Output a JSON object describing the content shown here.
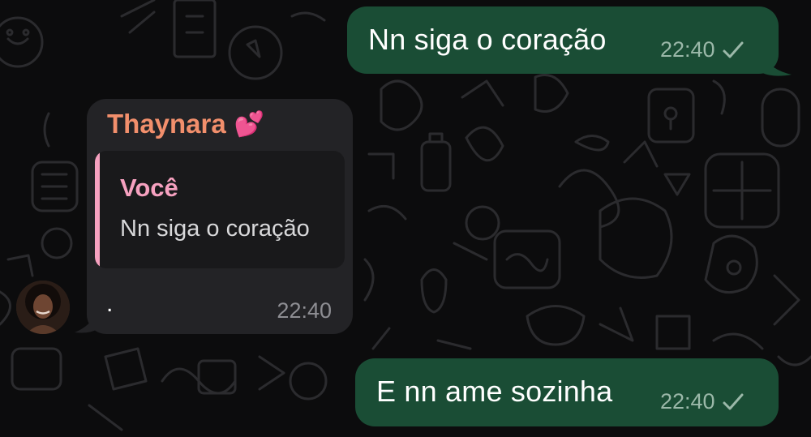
{
  "messages": {
    "out1": {
      "text": "Nn siga o coração",
      "time": "22:40",
      "status_icon": "check-icon"
    },
    "in1": {
      "sender": "Thaynara",
      "sender_emoji": "💕",
      "quote_author": "Você",
      "quote_text": "Nn siga o coração",
      "text": ".",
      "time": "22:40"
    },
    "out2": {
      "text": "E nn ame sozinha",
      "time": "22:40",
      "status_icon": "check-icon"
    }
  },
  "colors": {
    "outgoing_bubble": "#1a4d35",
    "incoming_bubble": "#232326",
    "sender_name": "#f28f6c",
    "quote_accent": "#f6a1c0",
    "background": "#0c0c0d"
  }
}
